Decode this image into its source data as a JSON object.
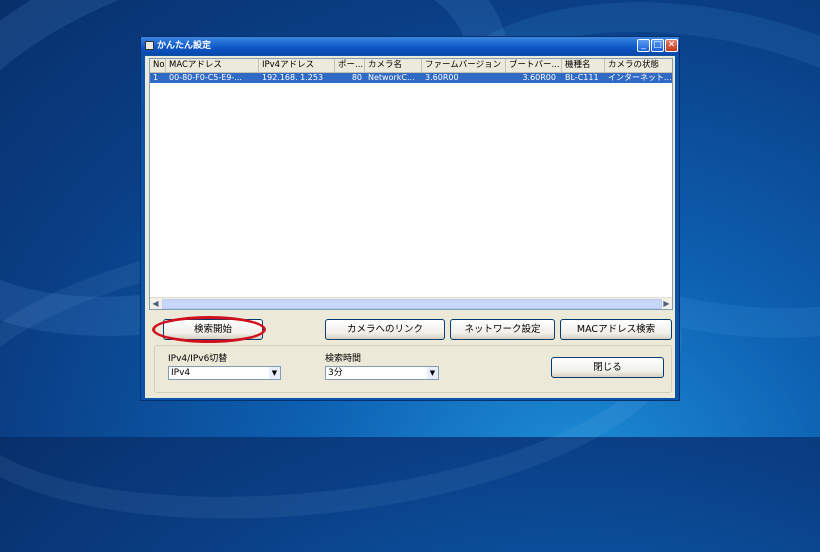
{
  "window": {
    "title": "かんたん設定"
  },
  "list": {
    "columns": [
      "No",
      "MACアドレス",
      "IPv4アドレス",
      "ポー...",
      "カメラ名",
      "ファームバージョン",
      "ブートバー...",
      "機種名",
      "カメラの状態"
    ],
    "rows": [
      [
        "1",
        "00-80-F0-C5-E9-...",
        "192.168.  1.253",
        "80",
        "NetworkC...",
        "3.60R00",
        "3.60R00",
        "BL-C111",
        "インターネット..."
      ]
    ]
  },
  "buttons": {
    "search_start": "検索開始",
    "camera_link": "カメラへのリンク",
    "network_settings": "ネットワーク設定",
    "mac_search": "MACアドレス検索",
    "close": "閉じる"
  },
  "ip_switch": {
    "label": "IPv4/IPv6切替",
    "value": "IPv4"
  },
  "search_time": {
    "label": "検索時間",
    "value": "3分"
  }
}
